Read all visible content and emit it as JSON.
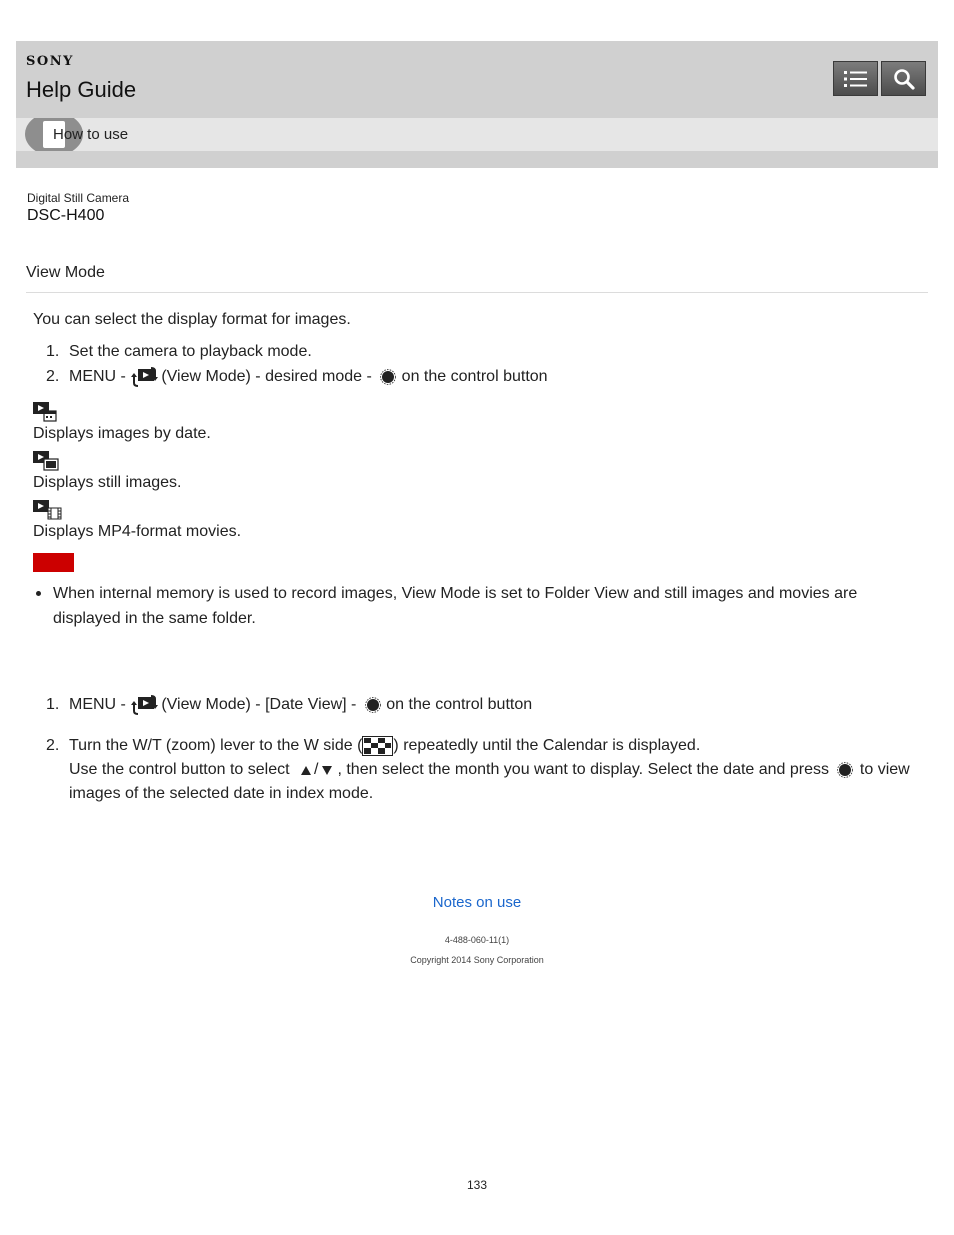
{
  "header": {
    "brand": "SONY",
    "title": "Help Guide",
    "subnav_label": "How to use"
  },
  "product": {
    "category": "Digital Still Camera",
    "model": "DSC-H400"
  },
  "page_title": "View Mode",
  "intro": "You can select the display format for images.",
  "steps": [
    {
      "num": "1.",
      "text": "Set the camera to playback mode."
    },
    {
      "num": "2.",
      "pre": "MENU - ",
      "post": "(View Mode) - desired mode - ",
      "end": " on the control button"
    }
  ],
  "modes": [
    {
      "icon": "date-view-icon",
      "desc": "Displays images by date."
    },
    {
      "icon": "still-view-icon",
      "desc": "Displays still images."
    },
    {
      "icon": "movie-view-icon",
      "desc": "Displays MP4-format movies."
    }
  ],
  "note": {
    "text": "When internal memory is used to record images, View Mode is set to Folder View and still images and movies are displayed in the same folder."
  },
  "calendar_steps": [
    {
      "num": "1.",
      "pre": "MENU - ",
      "post": "(View Mode) - [Date View] - ",
      "end": " on the control button"
    },
    {
      "num": "2.",
      "line1_pre": "Turn the W/T (zoom) lever to the W side (",
      "line1_post": ") repeatedly until the Calendar is displayed.",
      "line2_pre": "Use the control button to select ",
      "line2_sep": "/",
      "line2_mid": ", then select the month you want to display. Select the date and press ",
      "line2_post": " to view images of the selected date in index mode."
    }
  ],
  "link": "Notes on use",
  "footer": {
    "code": "4-488-060-11(1)",
    "copyright": "Copyright 2014 Sony Corporation",
    "page_number": "133"
  },
  "colors": {
    "header_bg": "#d0d0d0",
    "subnav_bg": "#e6e6e6",
    "note_bar": "#cc0000",
    "link": "#1a66cc"
  }
}
